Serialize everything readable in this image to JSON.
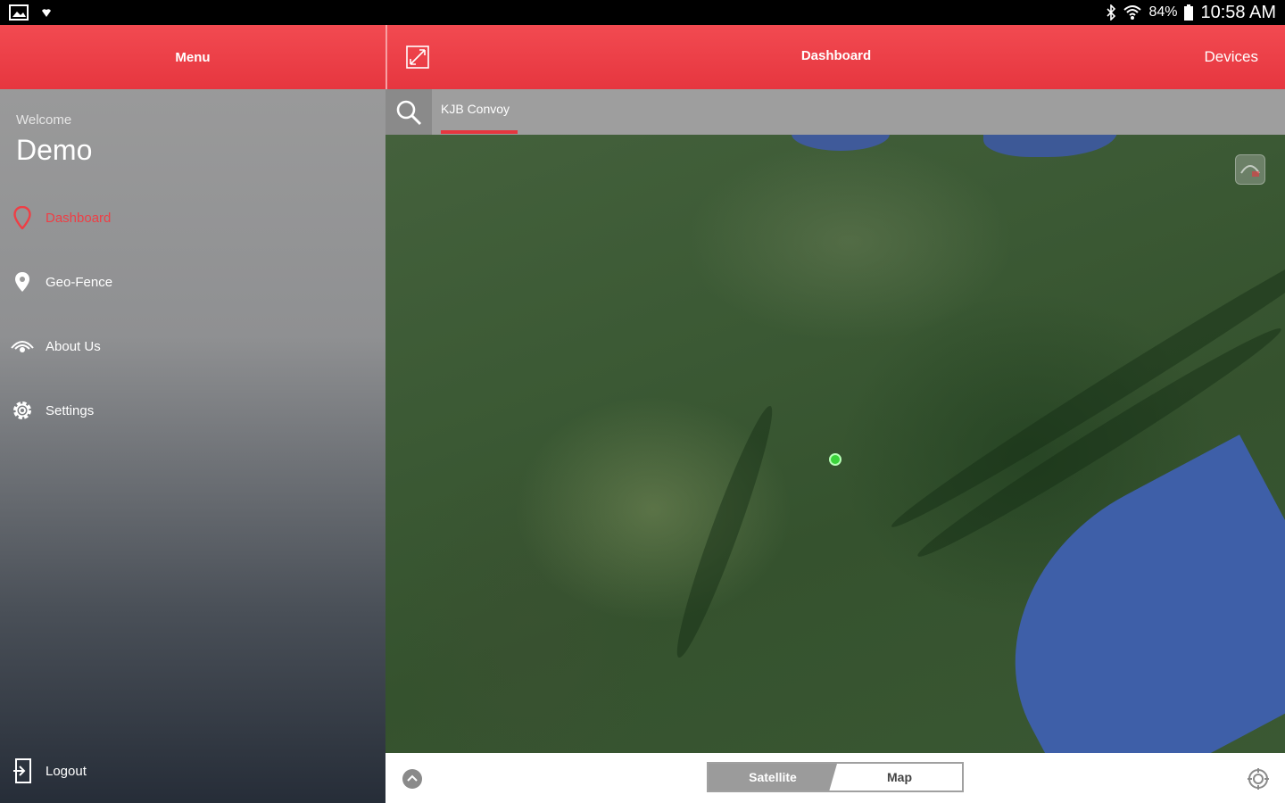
{
  "status": {
    "battery": "84%",
    "time": "10:58 AM"
  },
  "drawer": {
    "title": "Menu",
    "welcome": "Welcome",
    "username": "Demo",
    "items": [
      {
        "label": "Dashboard",
        "icon": "location-pin-icon",
        "active": true
      },
      {
        "label": "Geo-Fence",
        "icon": "location-pin-icon"
      },
      {
        "label": "About Us",
        "icon": "eye-icon"
      },
      {
        "label": "Settings",
        "icon": "gear-icon"
      }
    ],
    "logout": "Logout"
  },
  "header": {
    "title": "Dashboard",
    "devices": "Devices"
  },
  "search": {
    "tab_label": "KJB Convoy"
  },
  "map_toggle": {
    "satellite": "Satellite",
    "map": "Map",
    "selected": "Satellite"
  },
  "colors": {
    "accent": "#e6363f",
    "marker": "#3bd43b"
  }
}
